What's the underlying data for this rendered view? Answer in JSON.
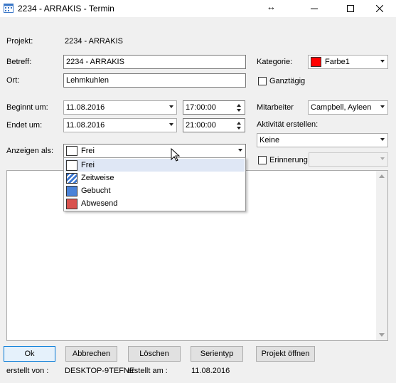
{
  "window": {
    "title": "2234 - ARRAKIS - Termin",
    "resize_glyph": "↔"
  },
  "projekt": {
    "label": "Projekt:",
    "value": "2234 - ARRAKIS"
  },
  "betreff": {
    "label": "Betreff:",
    "value": "2234 - ARRAKIS"
  },
  "ort": {
    "label": "Ort:",
    "value": "Lehmkuhlen"
  },
  "kategorie": {
    "label": "Kategorie:",
    "value": "Farbe1",
    "color": "#ff0000"
  },
  "ganztaegig": {
    "label": "Ganztägig",
    "checked": false
  },
  "beginn": {
    "label": "Beginnt um:",
    "date": "11.08.2016",
    "time": "17:00:00"
  },
  "ende": {
    "label": "Endet um:",
    "date": "11.08.2016",
    "time": "21:00:00"
  },
  "mitarbeiter": {
    "label": "Mitarbeiter",
    "value": "Campbell, Ayleen"
  },
  "aktivitaet": {
    "label": "Aktivität erstellen:",
    "value": "Keine"
  },
  "anzeigen": {
    "label": "Anzeigen als:",
    "value": "Frei",
    "options": [
      {
        "label": "Frei",
        "color": "#ffffff",
        "pattern": "none"
      },
      {
        "label": "Zeitweise",
        "color": "#3a76d0",
        "pattern": "hatched"
      },
      {
        "label": "Gebucht",
        "color": "#4a83d8",
        "pattern": "solid"
      },
      {
        "label": "Abwesend",
        "color": "#d9534f",
        "pattern": "solid"
      }
    ]
  },
  "erinnerung": {
    "label": "Erinnerung",
    "checked": false,
    "value": ""
  },
  "buttons": {
    "ok": "Ok",
    "abbrechen": "Abbrechen",
    "loeschen": "Löschen",
    "serientyp": "Serientyp",
    "projekt_oeffnen": "Projekt öffnen"
  },
  "footer": {
    "erstellt_von_label": "erstellt von :",
    "erstellt_von_value": "DESKTOP-9TEFNE",
    "erstellt_am_label": "erstellt am :",
    "erstellt_am_value": "11.08.2016"
  }
}
